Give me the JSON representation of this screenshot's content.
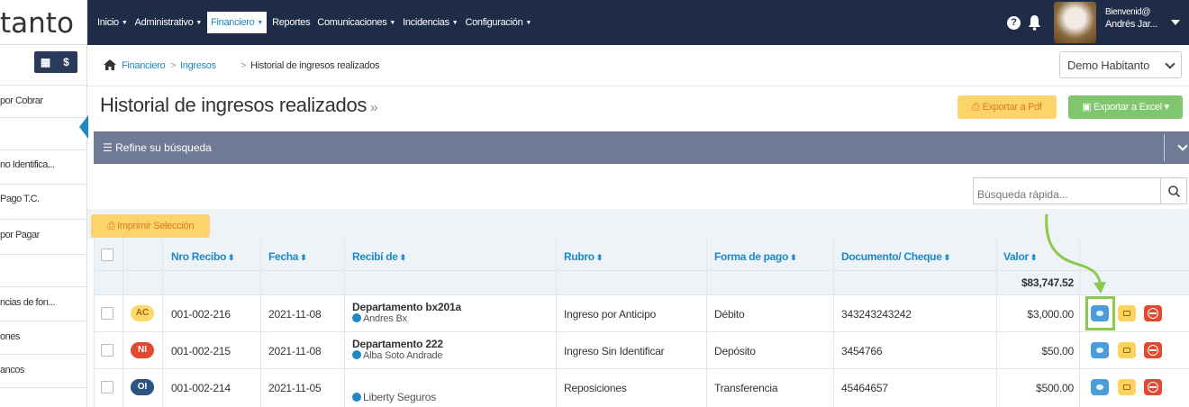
{
  "app": {
    "logo_text": "tanto"
  },
  "nav": [
    {
      "label": "Inicio",
      "caret": true,
      "active": false
    },
    {
      "label": "Administrativo",
      "caret": true,
      "active": false
    },
    {
      "label": "Financiero",
      "caret": true,
      "active": true
    },
    {
      "label": "Reportes",
      "caret": false,
      "active": false
    },
    {
      "label": "Comunicaciones",
      "caret": true,
      "active": false
    },
    {
      "label": "Incidencias",
      "caret": true,
      "active": false
    },
    {
      "label": "Configuración",
      "caret": true,
      "active": false
    }
  ],
  "user": {
    "welcome": "Bienvenid@",
    "name": "Andrés Jar..."
  },
  "sidebar": {
    "buttons": [
      "▦",
      "$"
    ],
    "items": [
      "por Cobrar",
      "no Identifica...",
      "Pago T.C.",
      "por Pagar",
      "ncias de fon...",
      "ones",
      "ancos"
    ]
  },
  "breadcrumb": {
    "links": [
      "Financiero",
      "Ingresos"
    ],
    "current": "Historial de ingresos realizados",
    "separator": ">"
  },
  "selector": {
    "value": "Demo Habitanto"
  },
  "page": {
    "title": "Historial de ingresos realizados",
    "title_suffix": "»",
    "export_pdf": "Exportar a Pdf",
    "export_excel": "Exportar a Excel",
    "refine_label": "Refine su búsqueda",
    "search_placeholder": "Búsqueda rápida...",
    "print_selection": "Imprimir Selección"
  },
  "table": {
    "columns": [
      "Nro Recibo",
      "Fecha",
      "Recibí de",
      "Rubro",
      "Forma de pago",
      "Documento/ Cheque",
      "Valor"
    ],
    "sort_glyph": "⬍",
    "total": "$83,747.52",
    "rows": [
      {
        "badge": "AC",
        "nro": "001-002-216",
        "fecha": "2021-11-08",
        "recibi": "Departamento bx201a",
        "persona": "Andres Bx",
        "rubro": "Ingreso por Anticipo",
        "forma": "Débito",
        "documento": "343243243242",
        "valor": "$3,000.00"
      },
      {
        "badge": "NI",
        "nro": "001-002-215",
        "fecha": "2021-11-08",
        "recibi": "Departamento 222",
        "persona": "Alba Soto Andrade",
        "rubro": "Ingreso Sin Identificar",
        "forma": "Depósito",
        "documento": "3454766",
        "valor": "$50.00"
      },
      {
        "badge": "OI",
        "nro": "001-002-214",
        "fecha": "2021-11-05",
        "recibi": "",
        "persona": "Liberty Seguros",
        "rubro": "Reposiciones",
        "forma": "Transferencia",
        "documento": "45464657",
        "valor": "$500.00"
      }
    ]
  },
  "colors": {
    "topbar": "#1f2c47",
    "accent": "#1e88c7",
    "pdf_button": "#fdd36b",
    "excel_button": "#7fc66e",
    "refine_bar": "#6f7a95",
    "highlight": "#8bc94a"
  }
}
